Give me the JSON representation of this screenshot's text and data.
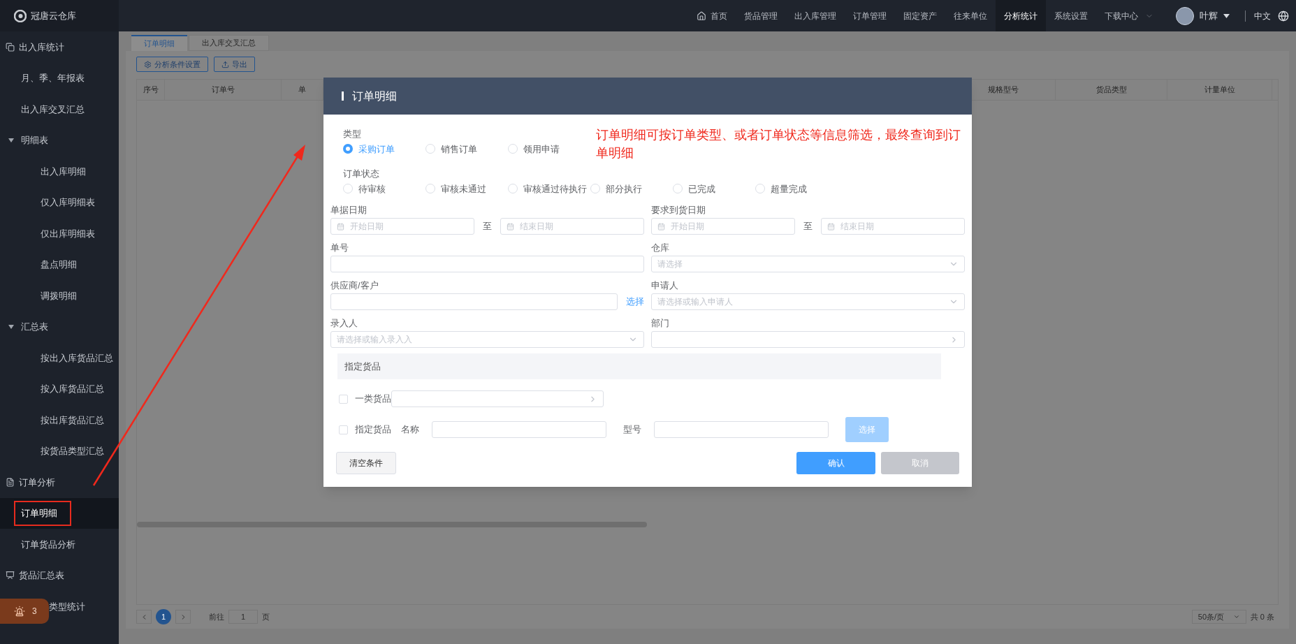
{
  "app": {
    "logo_text": "冠唐云仓库"
  },
  "nav": [
    {
      "label": "首页",
      "kind": "home",
      "selected": false
    },
    {
      "label": "货品管理",
      "kind": "plain",
      "selected": false
    },
    {
      "label": "出入库管理",
      "kind": "plain",
      "selected": false
    },
    {
      "label": "订单管理",
      "kind": "plain",
      "selected": false
    },
    {
      "label": "固定资产",
      "kind": "plain",
      "selected": false
    },
    {
      "label": "往来单位",
      "kind": "plain",
      "selected": false
    },
    {
      "label": "分析统计",
      "kind": "plain",
      "selected": true
    },
    {
      "label": "系统设置",
      "kind": "plain",
      "selected": false
    },
    {
      "label": "下载中心",
      "kind": "dropdown",
      "selected": false
    }
  ],
  "user": {
    "name": "叶辉"
  },
  "language": "中文",
  "sidebar": [
    {
      "label": "出入库统计",
      "kind": "group",
      "children": [
        {
          "label": "月、季、年报表",
          "selected": false
        },
        {
          "label": "出入库交叉汇总",
          "selected": false
        },
        {
          "label": "明细表",
          "expanded": true,
          "children": [
            {
              "label": "出入库明细",
              "selected": false
            },
            {
              "label": "仅入库明细表",
              "selected": false
            },
            {
              "label": "仅出库明细表",
              "selected": false
            },
            {
              "label": "盘点明细",
              "selected": false
            },
            {
              "label": "调拨明细",
              "selected": false
            }
          ]
        },
        {
          "label": "汇总表",
          "expanded": true,
          "children": [
            {
              "label": "按出入库货品汇总",
              "selected": false
            },
            {
              "label": "按入库货品汇总",
              "selected": false
            },
            {
              "label": "按出库货品汇总",
              "selected": false
            },
            {
              "label": "按货品类型汇总",
              "selected": false
            }
          ]
        }
      ]
    },
    {
      "label": "订单分析",
      "kind": "group",
      "children": [
        {
          "label": "订单明细",
          "selected": true
        },
        {
          "label": "订单货品分析",
          "selected": false
        }
      ]
    },
    {
      "label": "货品汇总表",
      "kind": "group",
      "children": [
        {
          "label": "类型统计",
          "selected": false
        }
      ]
    }
  ],
  "notification_badge": {
    "count": "3"
  },
  "tabs": [
    {
      "label": "订单明细",
      "selected": true
    },
    {
      "label": "出入库交叉汇总",
      "selected": false
    }
  ],
  "toolbar": [
    {
      "label": "分析条件设置",
      "kind": "settings"
    },
    {
      "label": "导出",
      "kind": "export"
    }
  ],
  "table": {
    "columns": [
      "序号",
      "订单号",
      "单",
      "规格型号",
      "货品类型",
      "计量单位"
    ]
  },
  "pagination": {
    "pages": [
      {
        "label": "1",
        "selected": true
      }
    ],
    "goto_label": "前往",
    "goto_value": "1",
    "page_suffix": "页",
    "page_size": "50条/页",
    "total": "共 0 条"
  },
  "modal": {
    "title": "订单明细",
    "type_group": {
      "label": "类型",
      "options": [
        {
          "label": "采购订单",
          "selected": true
        },
        {
          "label": "销售订单",
          "selected": false
        },
        {
          "label": "领用申请",
          "selected": false
        }
      ]
    },
    "status_group": {
      "label": "订单状态",
      "options": [
        {
          "label": "待审核",
          "selected": false
        },
        {
          "label": "审核未通过",
          "selected": false
        },
        {
          "label": "审核通过待执行",
          "selected": false
        },
        {
          "label": "部分执行",
          "selected": false
        },
        {
          "label": "已完成",
          "selected": false
        },
        {
          "label": "超量完成",
          "selected": false
        }
      ]
    },
    "fields": [
      {
        "label": "单据日期",
        "kind": "date_range",
        "start_placeholder": "开始日期",
        "separator": "至",
        "end_placeholder": "结束日期"
      },
      {
        "label": "要求到货日期",
        "kind": "date_range",
        "start_placeholder": "开始日期",
        "separator": "至",
        "end_placeholder": "结束日期"
      },
      {
        "label": "单号",
        "kind": "input"
      },
      {
        "label": "仓库",
        "kind": "select",
        "placeholder": "请选择"
      },
      {
        "label": "供应商/客户",
        "kind": "input_link",
        "link": "选择"
      },
      {
        "label": "申请人",
        "kind": "select",
        "placeholder": "请选择或输入申请人"
      },
      {
        "label": "录入人",
        "kind": "select",
        "placeholder": "请选择或输入录入入"
      },
      {
        "label": "部门",
        "kind": "cascader"
      }
    ],
    "goods_section": {
      "title": "指定货品",
      "category_row": {
        "label": "一类货品",
        "checked": false
      },
      "goods_row": {
        "label": "指定货品",
        "checked": false,
        "name_label": "名称",
        "model_label": "型号",
        "button": "选择",
        "button_disabled": true
      }
    },
    "buttons": [
      {
        "label": "清空条件",
        "kind": "default"
      },
      {
        "label": "确认",
        "kind": "primary"
      },
      {
        "label": "取消",
        "kind": "disabled"
      }
    ]
  },
  "annotation": {
    "note": "订单明细可按订单类型、或者订单状态等信息筛选，最终查询到订单明细"
  }
}
